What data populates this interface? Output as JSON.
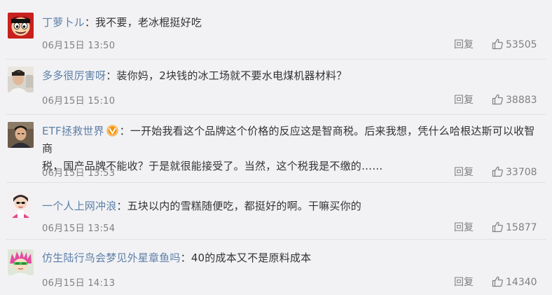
{
  "comments": [
    {
      "username": "丁萝卜ル",
      "separator": "：",
      "text": "我不要，老冰棍挺好吃",
      "time": "06月15日 13:50",
      "reply_label": "回复",
      "likes": "53505",
      "has_vip_badge": false,
      "avatar_icon": "cartoon-face-avatar"
    },
    {
      "username": "多多很厉害呀",
      "separator": "：",
      "text": "装你妈，2块钱的冰工场就不要水电煤机器材料？",
      "time": "06月15日 15:10",
      "reply_label": "回复",
      "likes": "38883",
      "has_vip_badge": false,
      "avatar_icon": "photo-avatar"
    },
    {
      "username": "ETF拯救世界",
      "separator": "：",
      "text_line1": "一开始我看这个品牌这个价格的反应这是智商税。后来我想，凭什么哈根达斯可以收智商",
      "text_line2": "税，国产品牌不能收？于是就很能接受了。当然，这个税我是不缴的……",
      "time": "06月15日 13:53",
      "reply_label": "回复",
      "likes": "33708",
      "has_vip_badge": true,
      "avatar_icon": "photo-avatar"
    },
    {
      "username": "一个人上网冲浪",
      "separator": "：",
      "text": "五块以内的雪糕随便吃，都挺好的啊。干嘛买你的",
      "time": "06月15日 13:54",
      "reply_label": "回复",
      "likes": "15877",
      "has_vip_badge": false,
      "avatar_icon": "cartoon-avatar"
    },
    {
      "username": "仿生陆行鸟会梦见外星章鱼吗",
      "separator": "：",
      "text": "40的成本又不是原料成本",
      "time": "06月15日 14:13",
      "reply_label": "回复",
      "likes": "14340",
      "has_vip_badge": false,
      "avatar_icon": "anime-avatar"
    }
  ],
  "colors": {
    "background": "#f2f2f5",
    "username": "#5d7fa6",
    "text": "#333333",
    "meta": "#808080",
    "vip_badge": "#f29100"
  }
}
